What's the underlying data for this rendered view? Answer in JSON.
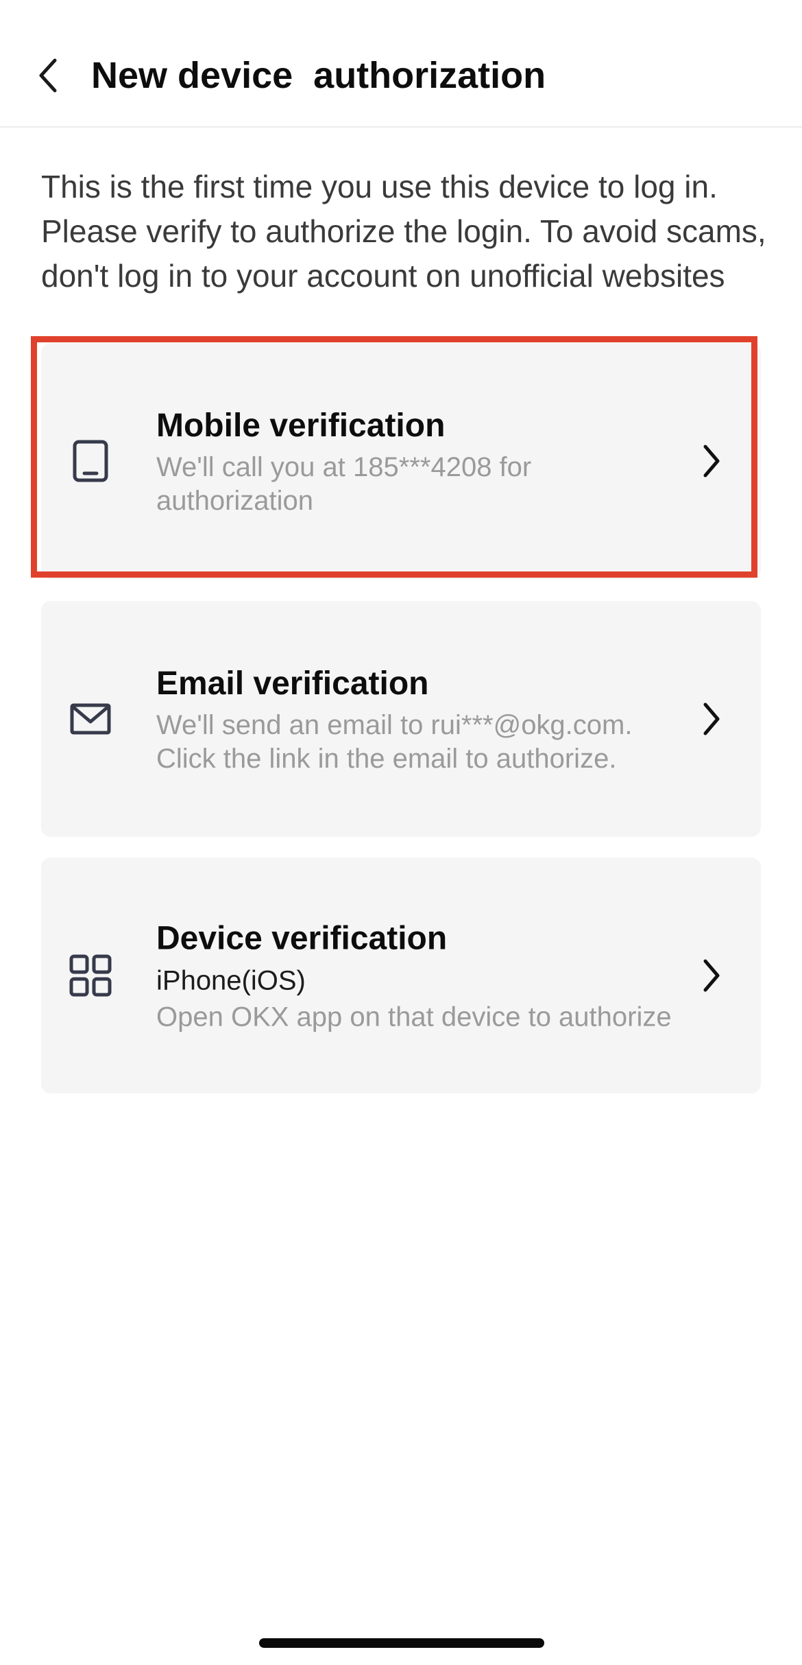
{
  "header": {
    "title": "New device  authorization",
    "back_icon": "chevron-left-icon"
  },
  "intro": "This is the first time you use this device to log in. Please verify to authorize the login. To avoid scams, don't log in to your account on unofficial websites",
  "options": [
    {
      "icon": "tablet-icon",
      "title": "Mobile verification",
      "desc": "We'll call you at 185***4208 for authorization",
      "highlighted": true
    },
    {
      "icon": "envelope-icon",
      "title": "Email verification",
      "desc": "We'll send an email to rui***@okg.com. Click the link in the email to authorize."
    },
    {
      "icon": "grid-icon",
      "title": "Device verification",
      "subtitle": "iPhone(iOS)",
      "desc": "Open OKX app on that device to authorize"
    }
  ],
  "colors": {
    "highlight": "#e0412c",
    "card_bg": "#f5f5f5",
    "muted_text": "#9a9a9a"
  }
}
